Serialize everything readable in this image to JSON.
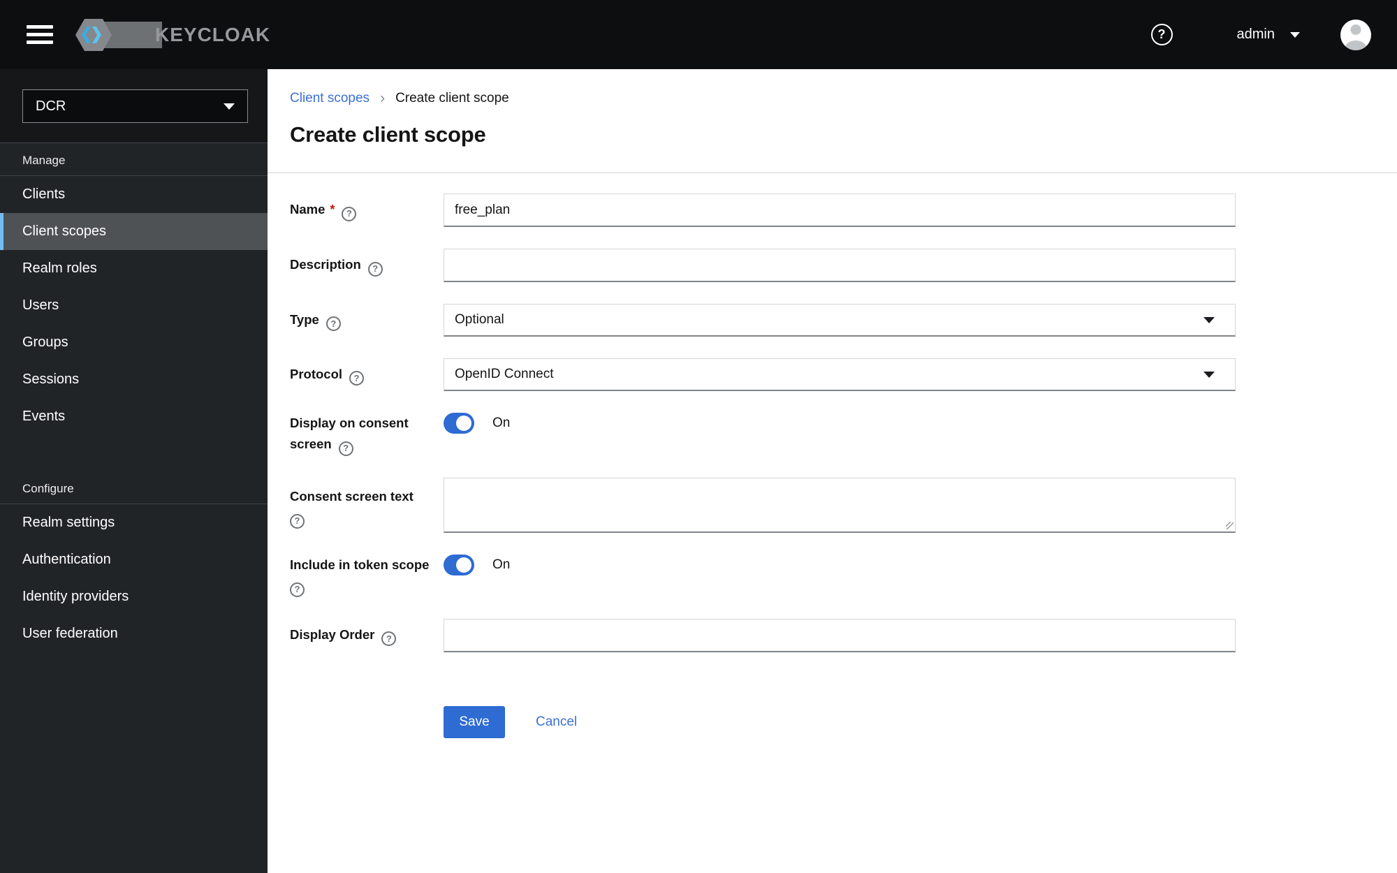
{
  "header": {
    "brand": "KEYCLOAK",
    "user_menu": {
      "label": "admin"
    }
  },
  "icons": {
    "help_glyph": "?"
  },
  "sidebar": {
    "realm_selector": {
      "value": "DCR"
    },
    "sections": [
      {
        "label": "Manage",
        "items": [
          {
            "label": "Clients",
            "selected": false
          },
          {
            "label": "Client scopes",
            "selected": true
          },
          {
            "label": "Realm roles",
            "selected": false
          },
          {
            "label": "Users",
            "selected": false
          },
          {
            "label": "Groups",
            "selected": false
          },
          {
            "label": "Sessions",
            "selected": false
          },
          {
            "label": "Events",
            "selected": false
          }
        ]
      },
      {
        "label": "Configure",
        "items": [
          {
            "label": "Realm settings",
            "selected": false
          },
          {
            "label": "Authentication",
            "selected": false
          },
          {
            "label": "Identity providers",
            "selected": false
          },
          {
            "label": "User federation",
            "selected": false
          }
        ]
      }
    ]
  },
  "breadcrumb": {
    "parent": "Client scopes",
    "separator": "›",
    "current": "Create client scope"
  },
  "page": {
    "title": "Create client scope"
  },
  "form": {
    "name": {
      "label": "Name",
      "required_marker": "*",
      "value": "free_plan"
    },
    "description": {
      "label": "Description",
      "value": ""
    },
    "type": {
      "label": "Type",
      "value": "Optional"
    },
    "protocol": {
      "label": "Protocol",
      "value": "OpenID Connect"
    },
    "display_on_consent": {
      "label": "Display on consent screen",
      "state": "On"
    },
    "consent_text": {
      "label": "Consent screen text",
      "value": ""
    },
    "include_in_token": {
      "label": "Include in token scope",
      "state": "On"
    },
    "display_order": {
      "label": "Display Order",
      "value": ""
    }
  },
  "actions": {
    "save": "Save",
    "cancel": "Cancel"
  },
  "colors": {
    "accent_primary": "#2e6bd3",
    "link_blue": "#3c70d6",
    "selected_nav_background": "#4f5255",
    "selected_nav_border": "#73bcf7",
    "header_background": "#0d0e0f",
    "sidebar_background": "#212427",
    "required_red": "#c9190b"
  }
}
